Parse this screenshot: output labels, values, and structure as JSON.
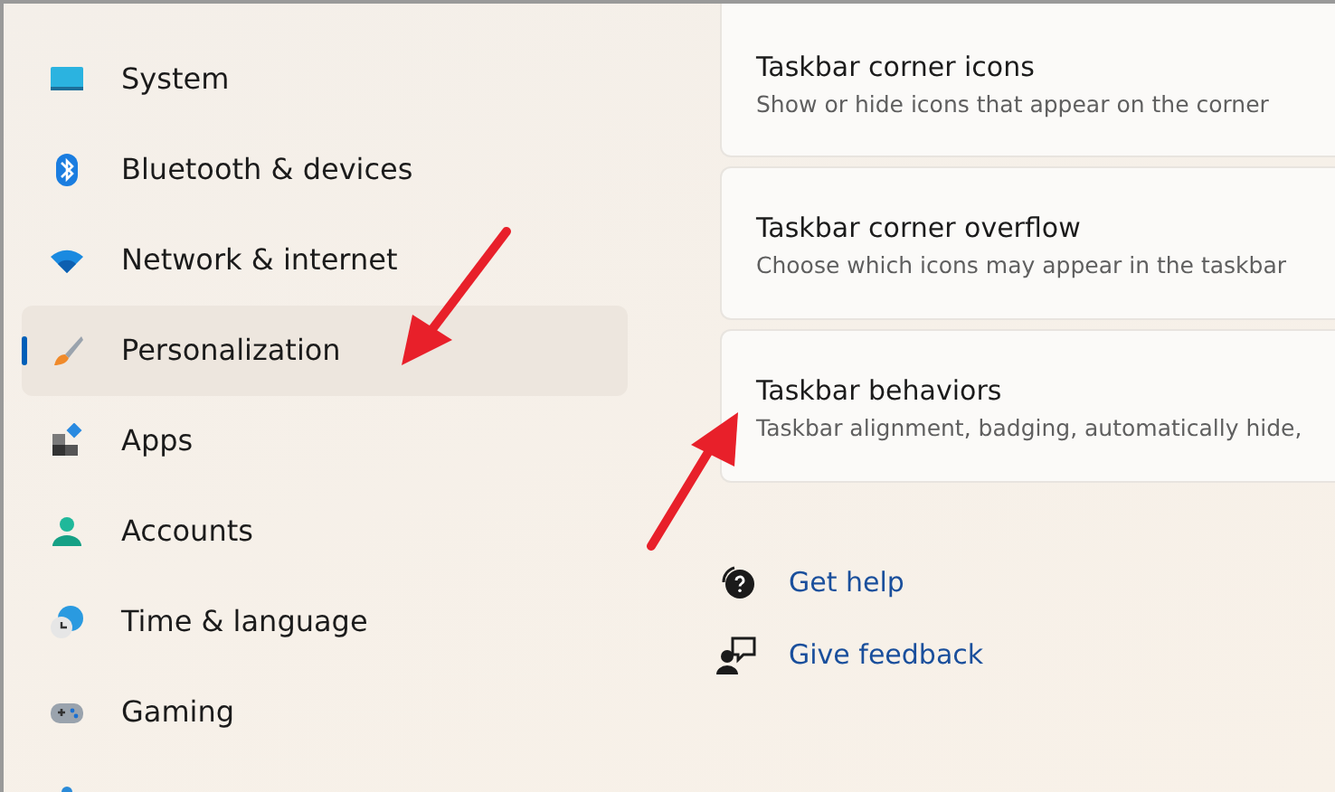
{
  "sidebar": {
    "items": [
      {
        "label": "System",
        "kind": "system",
        "selected": false
      },
      {
        "label": "Bluetooth & devices",
        "kind": "bluetooth",
        "selected": false
      },
      {
        "label": "Network & internet",
        "kind": "network",
        "selected": false
      },
      {
        "label": "Personalization",
        "kind": "personalization",
        "selected": true
      },
      {
        "label": "Apps",
        "kind": "apps",
        "selected": false
      },
      {
        "label": "Accounts",
        "kind": "accounts",
        "selected": false
      },
      {
        "label": "Time & language",
        "kind": "time",
        "selected": false
      },
      {
        "label": "Gaming",
        "kind": "gaming",
        "selected": false
      }
    ]
  },
  "settings": [
    {
      "title": "Taskbar corner icons",
      "description": "Show or hide icons that appear on the corner"
    },
    {
      "title": "Taskbar corner overflow",
      "description": "Choose which icons may appear in the taskbar"
    },
    {
      "title": "Taskbar behaviors",
      "description": "Taskbar alignment, badging, automatically hide,"
    }
  ],
  "links": [
    {
      "label": "Get help",
      "kind": "help"
    },
    {
      "label": "Give feedback",
      "kind": "feedback"
    }
  ]
}
